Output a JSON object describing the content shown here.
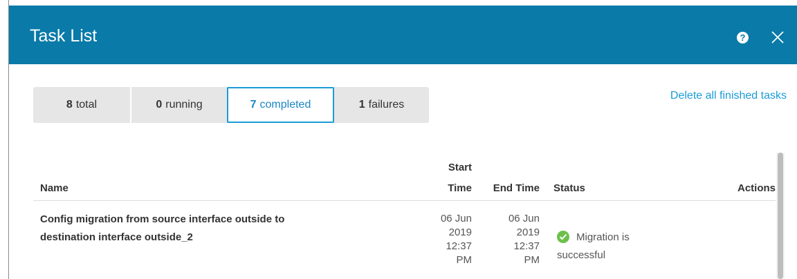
{
  "dialog": {
    "title": "Task List",
    "help_icon": "question-circle-icon",
    "close_icon": "close-icon",
    "colors": {
      "header": "#0a7aa8",
      "accent": "#1a9bd7",
      "success": "#6cc04a"
    }
  },
  "filters": [
    {
      "count": "8",
      "label": "total"
    },
    {
      "count": "0",
      "label": "running"
    },
    {
      "count": "7",
      "label": "completed",
      "active": true
    },
    {
      "count": "1",
      "label": "failures"
    }
  ],
  "delete_link": "Delete all finished tasks",
  "table": {
    "headers": {
      "name": "Name",
      "start_time_1": "Start",
      "start_time_2": "Time",
      "end_time": "End Time",
      "status": "Status",
      "actions": "Actions"
    },
    "rows": [
      {
        "name_line1": "Config migration from source interface outside to",
        "name_line2": "destination interface outside_2",
        "start": [
          "06 Jun",
          "2019",
          "12:37",
          "PM"
        ],
        "end": [
          "06 Jun",
          "2019",
          "12:37",
          "PM"
        ],
        "status_line1": "Migration is",
        "status_line2": "successful",
        "status_icon": "success-check-icon"
      }
    ]
  }
}
